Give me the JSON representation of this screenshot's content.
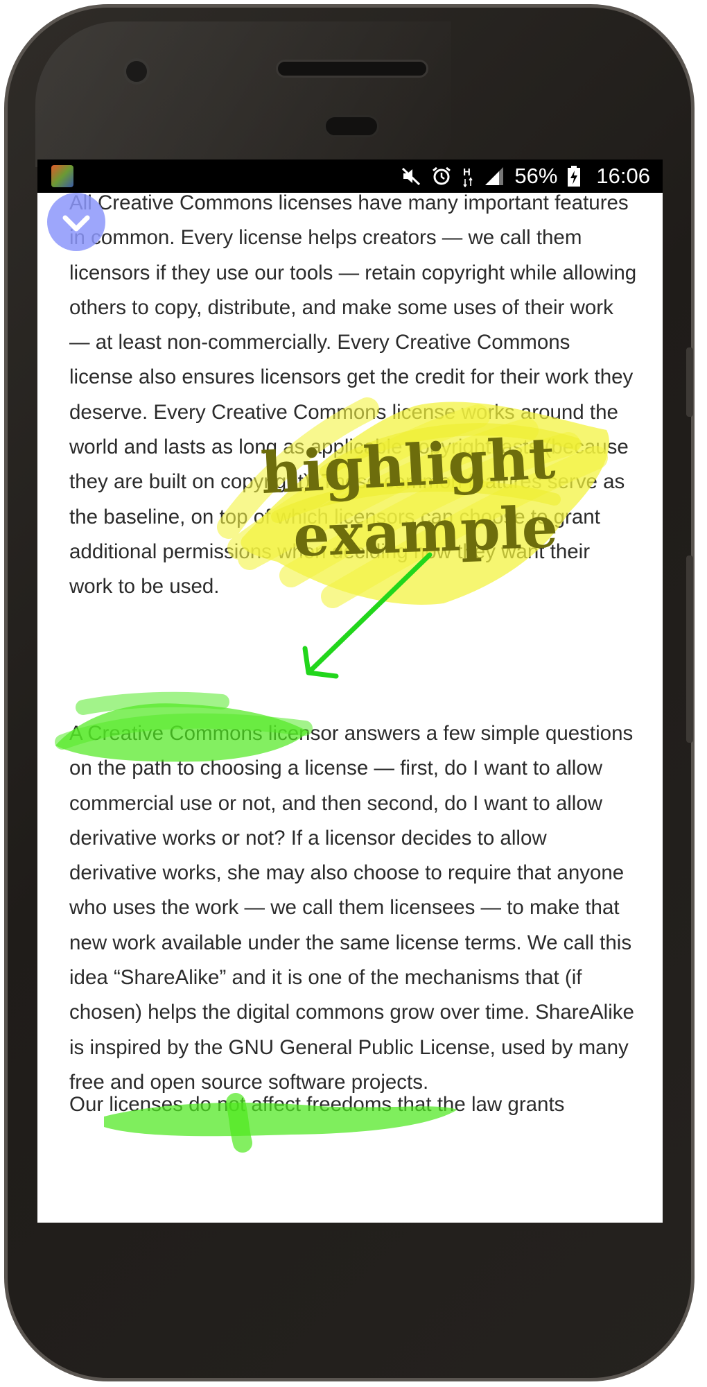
{
  "status_bar": {
    "battery_percent": "56%",
    "time": "16:06",
    "icons": [
      "app-notification-icon",
      "mute-icon",
      "alarm-icon",
      "data-h-icon",
      "signal-icon",
      "battery-charging-icon"
    ]
  },
  "collapse_button": {
    "icon": "chevron-down-icon",
    "color": "#8c96fa"
  },
  "article": {
    "paragraph_1": "All Creative Commons licenses have many important features in common. Every license helps creators — we call them licensors if they use our tools — retain copyright while allowing others to copy, distribute, and make some uses of their work — at least non-commercially. Every Creative Commons license also ensures licensors get the credit for their work they deserve. Every Creative Commons license works around the world and lasts as long as applicable copyright lasts (because they are built on copyright). These common features serve as the baseline, on top of which licensors can choose to grant additional permissions when deciding how they want their work to be used.",
    "paragraph_2": "A Creative Commons licensor answers a few simple questions on the path to choosing a license — first, do I want to allow commercial use or not, and then second, do I want to allow derivative works or not? If a licensor decides to allow derivative works, she may also choose to require that anyone who uses the work — we call them licensees — to make that new work available under the same license terms. We call this idea “ShareAlike” and it is one of the mechanisms that (if chosen) helps the digital commons grow over time. ShareAlike is inspired by the GNU General Public License, used by many free and open source software projects.",
    "paragraph_3": "Our licenses do not affect freedoms that the law grants"
  },
  "annotation": {
    "label_line1": "highlight",
    "label_line2": "example",
    "yellow_highlight_color": "#f2f23a",
    "green_highlight_color": "#4ee81e",
    "label_color": "#6d6d0c",
    "arrow_color": "#22d61c"
  }
}
